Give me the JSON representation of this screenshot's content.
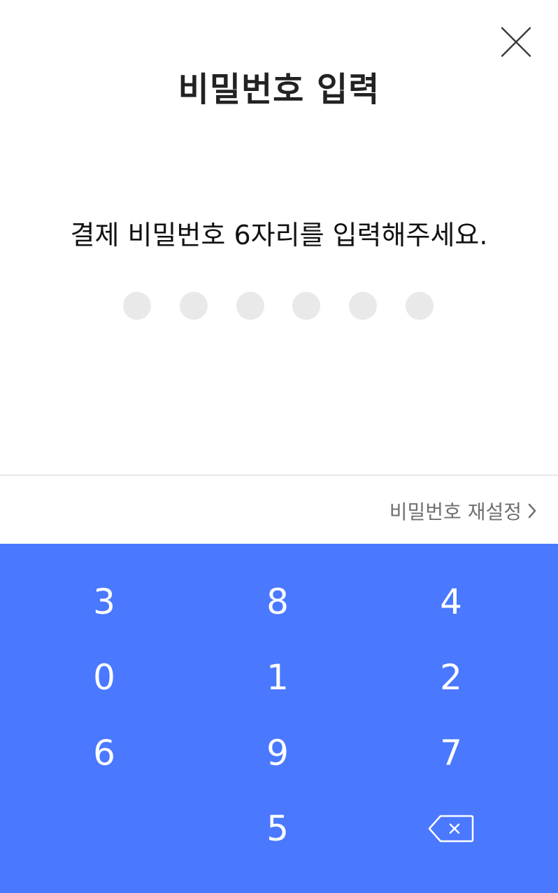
{
  "header": {
    "title": "비밀번호 입력",
    "close_icon": "close-icon"
  },
  "main": {
    "instruction": "결제 비밀번호 6자리를 입력해주세요.",
    "pin_length": 6,
    "entered_digits": 0
  },
  "links": {
    "reset_password": "비밀번호 재설정"
  },
  "keypad": {
    "background_color": "#4a78ff",
    "keys": [
      "3",
      "8",
      "4",
      "0",
      "1",
      "2",
      "6",
      "9",
      "7",
      "",
      "5",
      "backspace"
    ],
    "backspace_icon": "backspace-icon"
  }
}
